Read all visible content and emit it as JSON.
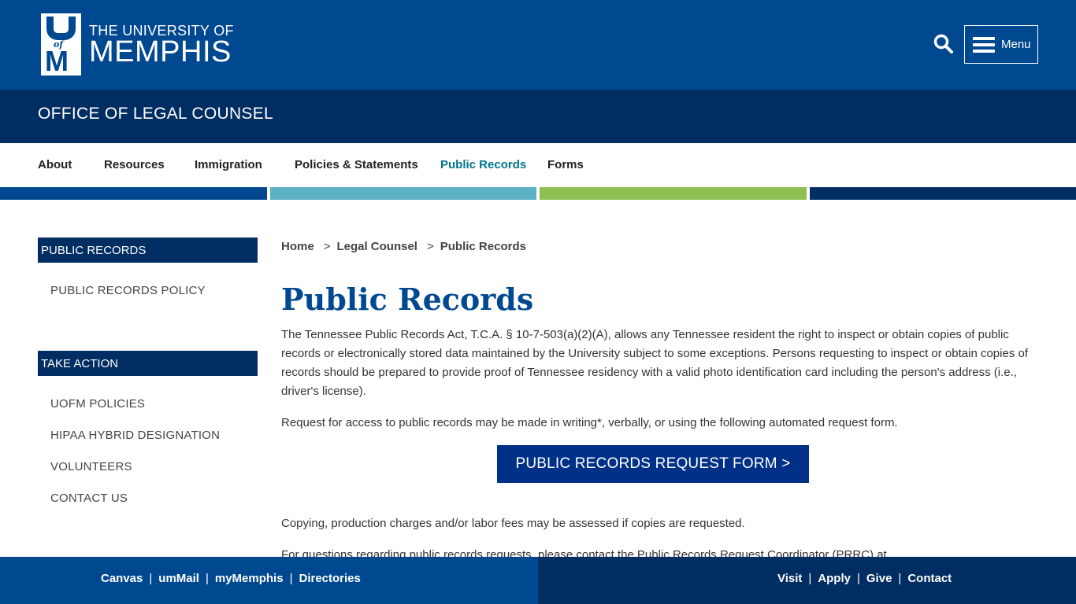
{
  "header": {
    "logo_line1": "THE UNIVERSITY OF",
    "logo_line2": "MEMPHIS",
    "logo_mark_u": "U",
    "logo_mark_of": "of",
    "logo_mark_m": "M",
    "menu_label": "Menu",
    "search_icon": "search-icon",
    "menu_icon": "hamburger-icon"
  },
  "office": {
    "title": "OFFICE OF LEGAL COUNSEL"
  },
  "nav": {
    "items": [
      {
        "label": "About"
      },
      {
        "label": "Resources"
      },
      {
        "label": "Immigration"
      },
      {
        "label": "Policies & Statements"
      },
      {
        "label": "Public Records"
      },
      {
        "label": "Forms"
      }
    ],
    "active": "Public Records"
  },
  "colors": {
    "brand_blue": "#004990",
    "navy": "#002d62",
    "teal": "#5db1c4",
    "green": "#8dc050",
    "link_active": "#00758f",
    "button_blue": "#003087"
  },
  "sidebar": {
    "section1_title": "PUBLIC RECORDS",
    "section1_items": [
      {
        "label": "PUBLIC RECORDS POLICY"
      }
    ],
    "section2_title": "TAKE ACTION",
    "section2_items": [
      {
        "label": "UOFM POLICIES"
      },
      {
        "label": "HIPAA HYBRID DESIGNATION"
      },
      {
        "label": "VOLUNTEERS"
      },
      {
        "label": "CONTACT US"
      }
    ]
  },
  "breadcrumb": {
    "items": [
      "Home",
      "Legal Counsel",
      "Public Records"
    ],
    "separator": ">"
  },
  "main": {
    "title": "Public Records",
    "paragraph1": "The Tennessee Public Records Act, T.C.A. § 10-7-503(a)(2)(A), allows any Tennessee resident the right to inspect or obtain copies of public records or electronically stored data maintained by the University subject to some exceptions. Persons requesting to inspect or obtain copies of records should be prepared to provide proof of Tennessee residency with a valid photo identification card including the person's address (i.e., driver's license).",
    "paragraph2": "Request for access to public records may be made in writing*, verbally, or using the following automated request form.",
    "cta_label": "PUBLIC RECORDS REQUEST FORM >",
    "paragraph3": "Copying, production charges and/or labor fees may be assessed if copies are requested.",
    "paragraph4": "For questions regarding public records requests, please contact the Public Records Request Coordinator (PRRC) at"
  },
  "footer": {
    "left_links": [
      "Canvas",
      "umMail",
      "myMemphis",
      "Directories"
    ],
    "right_links": [
      "Visit",
      "Apply",
      "Give",
      "Contact"
    ],
    "separator": "|"
  }
}
